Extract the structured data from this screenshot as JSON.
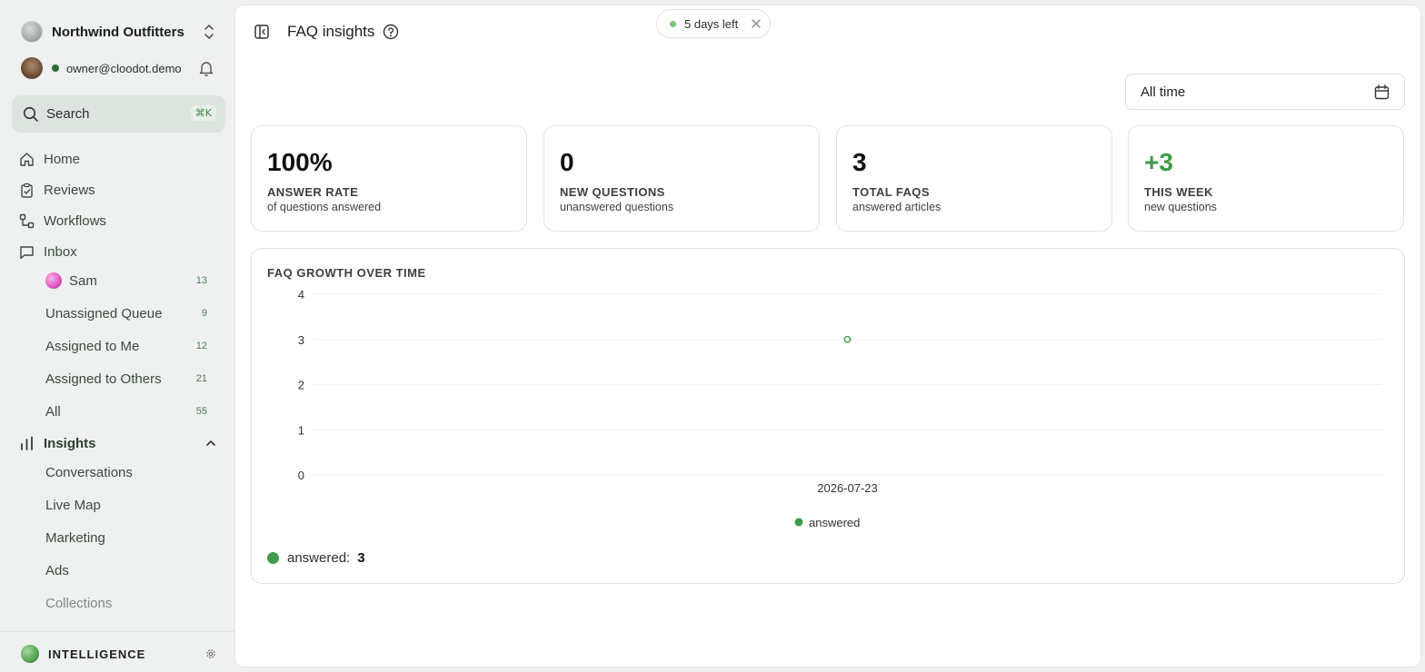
{
  "sidebar": {
    "org_name": "Northwind Outfitters",
    "user_email": "owner@cloodot.demo",
    "search": {
      "label": "Search",
      "shortcut": "⌘K"
    },
    "nav": {
      "home": "Home",
      "reviews": "Reviews",
      "workflows": "Workflows",
      "inbox": "Inbox",
      "insights": "Insights"
    },
    "inbox_items": [
      {
        "label": "Sam",
        "count": "13"
      },
      {
        "label": "Unassigned Queue",
        "count": "9"
      },
      {
        "label": "Assigned to Me",
        "count": "12"
      },
      {
        "label": "Assigned to Others",
        "count": "21"
      },
      {
        "label": "All",
        "count": "55"
      }
    ],
    "insights_items": [
      {
        "label": "Conversations"
      },
      {
        "label": "Live Map"
      },
      {
        "label": "Marketing"
      },
      {
        "label": "Ads"
      },
      {
        "label": "Collections"
      }
    ],
    "footer_label": "INTELLIGENCE"
  },
  "header": {
    "title": "FAQ insights",
    "trial_badge": "5 days left"
  },
  "filters": {
    "date_range": "All time"
  },
  "stats": [
    {
      "value": "100%",
      "label": "ANSWER RATE",
      "sub": "of questions answered",
      "accent": false
    },
    {
      "value": "0",
      "label": "NEW QUESTIONS",
      "sub": "unanswered questions",
      "accent": false
    },
    {
      "value": "3",
      "label": "TOTAL FAQS",
      "sub": "answered articles",
      "accent": false
    },
    {
      "value": "+3",
      "label": "THIS WEEK",
      "sub": "new questions",
      "accent": true
    }
  ],
  "chart_data": {
    "type": "line",
    "title": "FAQ GROWTH OVER TIME",
    "x": [
      "2026-07-23"
    ],
    "series": [
      {
        "name": "answered",
        "values": [
          3
        ],
        "color": "#3f9a4a"
      }
    ],
    "ylim": [
      0,
      4
    ],
    "yticks": [
      "0",
      "1",
      "2",
      "3",
      "4"
    ],
    "grid": true,
    "legend": "bottom-center"
  },
  "summary": {
    "label": "answered:",
    "value": "3"
  },
  "colors": {
    "accent": "#3f9a4a",
    "sidebar_bg": "#eef1ef"
  }
}
